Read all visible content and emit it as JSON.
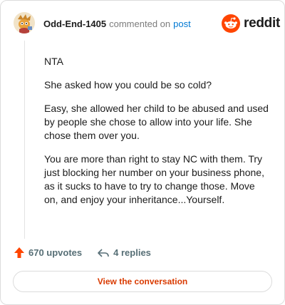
{
  "comment": {
    "username": "Odd-End-1405",
    "commented_on": "commented on",
    "post_link": "post",
    "paragraphs": [
      "NTA",
      "She asked how you could be so cold?",
      "Easy, she allowed her child to be abused and used by people she chose to allow into your life. She chose them over you.",
      "You are more than right to stay NC with them. Try just blocking her number on your business phone, as it sucks to have to try to change those. Move on, and enjoy your inheritance...Yourself."
    ]
  },
  "brand": {
    "name": "reddit",
    "color": "#ff4500"
  },
  "actions": {
    "upvotes": "670 upvotes",
    "replies": "4 replies"
  },
  "view_button": {
    "label": "View the conversation",
    "color": "#d93a00"
  },
  "icons": [
    "user-avatar",
    "reddit-snoo-icon",
    "upvote-arrow-icon",
    "reply-arrow-icon"
  ]
}
